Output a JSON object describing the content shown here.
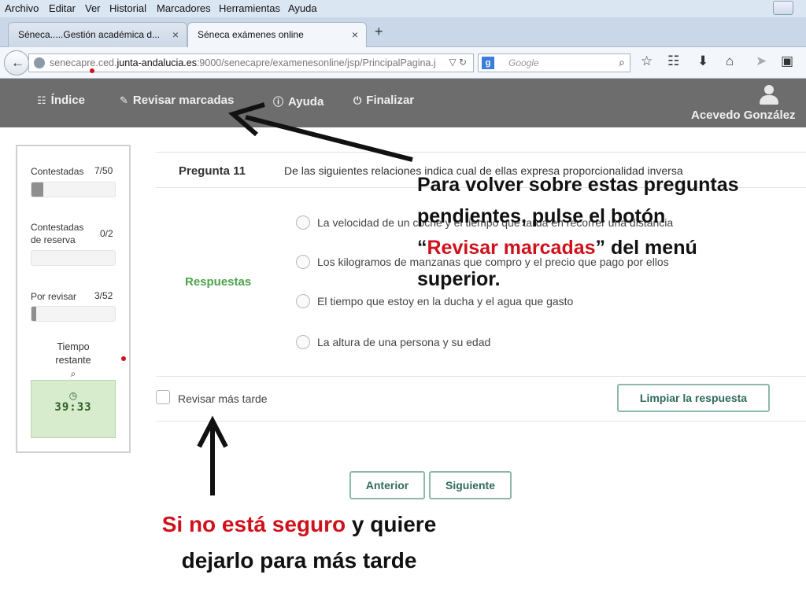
{
  "browser": {
    "menu": [
      "Archivo",
      "Editar",
      "Ver",
      "Historial",
      "Marcadores",
      "Herramientas",
      "Ayuda"
    ],
    "tabs": [
      {
        "title": "Séneca.....Gestión académica d...",
        "close": "×"
      },
      {
        "title": "Séneca exámenes online",
        "close": "×"
      }
    ],
    "new_tab": "+",
    "url_prefix": "senecapre.ced.",
    "url_host": "junta-andalucia.es",
    "url_suffix": ":9000/senecapre/examenesonline/jsp/PrincipalPagina.j",
    "search_engine": "g",
    "search_placeholder": "Google"
  },
  "app": {
    "nav": [
      {
        "icon": "sitemap-icon",
        "label": "Índice"
      },
      {
        "icon": "pencil-icon",
        "label": "Revisar marcadas"
      },
      {
        "icon": "info-icon",
        "label": "Ayuda"
      },
      {
        "icon": "power-icon",
        "label": "Finalizar"
      }
    ],
    "user_name": "Acevedo González"
  },
  "sidebar": {
    "contestadas_label": "Contestadas",
    "contestadas_value": "7/50",
    "contestadas_progress": 0.14,
    "reserva_label_1": "Contestadas",
    "reserva_label_2": "de reserva",
    "reserva_value": "0/2",
    "reserva_progress": 0,
    "revisar_label": "Por revisar",
    "revisar_value": "3/52",
    "revisar_progress": 0.06,
    "tiempo_label_1": "Tiempo",
    "tiempo_label_2": "restante",
    "timer": "39:33"
  },
  "question": {
    "number_label": "Pregunta 11",
    "text": "De las siguientes relaciones indica cual de ellas expresa proporcionalidad inversa",
    "answers_label": "Respuestas",
    "options": [
      "La velocidad de un coche y el tiempo que tarda en recorrer una distancia",
      "Los kilogramos de manzanas que compro y el precio que pago por ellos",
      "El tiempo que estoy en la ducha y el agua que gasto",
      "La altura de una persona y su edad"
    ],
    "review_later": "Revisar más tarde",
    "clear_button": "Limpiar la respuesta",
    "prev_button": "Anterior",
    "next_button": "Siguiente"
  },
  "annotations": {
    "top_line1": "Para volver sobre estas preguntas",
    "top_line2": "pendientes, pulse el botón",
    "top_quote_open": "“",
    "top_highlight": "Revisar marcadas",
    "top_line3_rest": "” del menú superior.",
    "bottom_highlight": "Si no está seguro",
    "bottom_rest1": " y quiere",
    "bottom_line2": "dejarlo para más tarde"
  },
  "colors": {
    "accent_green": "#4ca24a",
    "annotation_red": "#d0111b",
    "header_gray": "#6d6d6d"
  }
}
